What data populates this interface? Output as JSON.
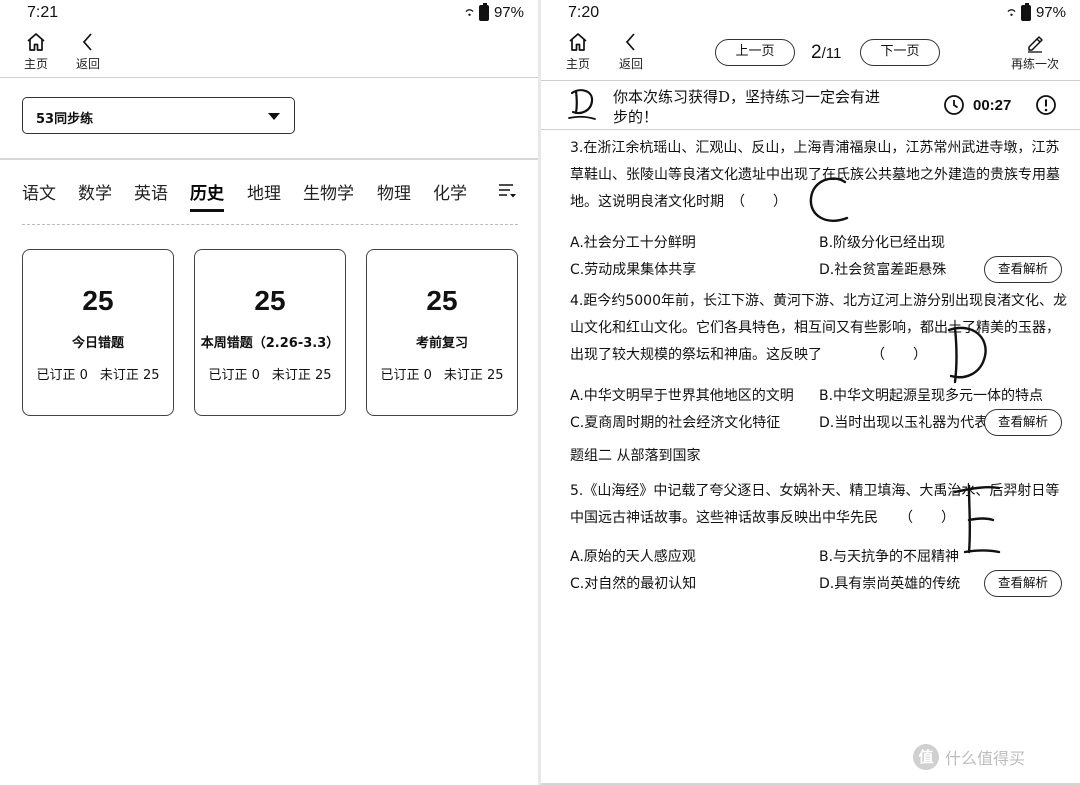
{
  "left": {
    "status": {
      "time": "7:21",
      "battery": "97%"
    },
    "nav": {
      "home_label": "主页",
      "back_label": "返回"
    },
    "selector": {
      "value": "53同步练"
    },
    "tabs": [
      {
        "label": "语文"
      },
      {
        "label": "数学"
      },
      {
        "label": "英语"
      },
      {
        "label": "历史"
      },
      {
        "label": "地理"
      },
      {
        "label": "生物学"
      },
      {
        "label": "物理"
      },
      {
        "label": "化学"
      }
    ],
    "active_tab": "历史",
    "cards": [
      {
        "count": "25",
        "title": "今日错题",
        "corrected": "已订正 0",
        "uncorrected": "未订正 25"
      },
      {
        "count": "25",
        "title": "本周错题（2.26-3.3）",
        "corrected": "已订正 0",
        "uncorrected": "未订正 25"
      },
      {
        "count": "25",
        "title": "考前复习",
        "corrected": "已订正 0",
        "uncorrected": "未订正 25"
      }
    ]
  },
  "right": {
    "status": {
      "time": "7:20",
      "battery": "97%"
    },
    "nav": {
      "home_label": "主页",
      "back_label": "返回",
      "redo_label": "再练一次"
    },
    "pager": {
      "prev_label": "上一页",
      "next_label": "下一页",
      "current": "2",
      "total": "/11"
    },
    "feedback": {
      "grade": "D",
      "message": "你本次练习获得D，坚持练习一定会有进步的！",
      "timer": "00:27"
    },
    "questions": [
      {
        "stem": "3.在浙江余杭瑶山、汇观山、反山，上海青浦福泉山，江苏常州武进寺墩，江苏草鞋山、张陵山等良渚文化遗址中出现了在氏族公共墓地之外建造的贵族专用墓地。这说明良渚文化时期　（　　）",
        "options": [
          "A.社会分工十分鲜明",
          "B.阶级分化已经出现",
          "C.劳动成果集体共享",
          "D.社会贫富差距悬殊"
        ],
        "explain_label": "查看解析"
      },
      {
        "stem": "4.距今约5000年前，长江下游、黄河下游、北方辽河上游分别出现良渚文化、龙山文化和红山文化。它们各具特色，相互间又有些影响，都出土了精美的玉器，出现了较大规模的祭坛和神庙。这反映了　　　　（　　）",
        "options": [
          "A.中华文明早于世界其他地区的文明",
          "B.中华文明起源呈现多元一体的特点",
          "C.夏商周时期的社会经济文化特征",
          "D.当时出现以玉礼器为代表"
        ],
        "explain_label": "查看解析"
      },
      {
        "stem": "5.《山海经》中记载了夸父逐日、女娲补天、精卫填海、大禹治水、后羿射日等中国远古神话故事。这些神话故事反映出中华先民　　（　　）",
        "options": [
          "A.原始的天人感应观",
          "B.与天抗争的不屈精神",
          "C.对自然的最初认知",
          "D.具有崇尚英雄的传统"
        ],
        "explain_label": "查看解析"
      }
    ],
    "group_title": "题组二 从部落到国家",
    "watermark": "什么值得买",
    "watermark_badge": "值"
  }
}
